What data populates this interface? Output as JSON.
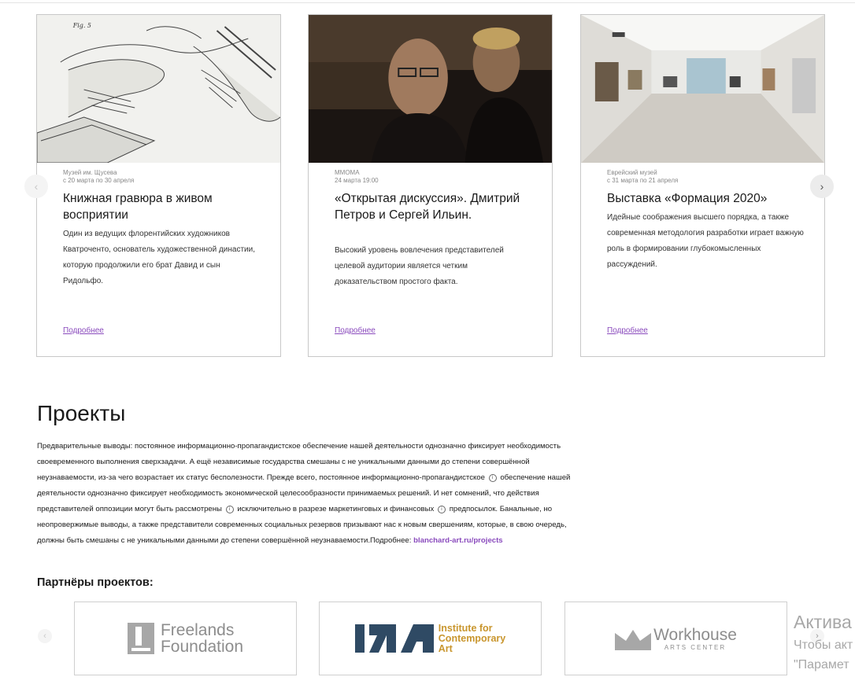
{
  "cards": [
    {
      "venue": "Музей им. Щусева",
      "date": "с 20 марта по 30 апреля",
      "title": "Книжная гравюра в живом восприятии",
      "description": "Один из ведущих флорентийских художников Кватроченто, основатель художественной династии, которую продолжили его брат Давид и сын Ридольфо.",
      "more": "Подробнее",
      "fig_label": "Fig. 5"
    },
    {
      "venue": "ММОМА",
      "date": "24 марта 19:00",
      "title": "«Открытая дискуссия». Дмитрий Петров и Сергей Ильин.",
      "description": "Высокий уровень вовлечения представителей целевой аудитории является четким доказательством простого факта.",
      "more": "Подробнее"
    },
    {
      "venue": "Еврейский музей",
      "date": "с 31 марта по 21 апреля",
      "title": "Выставка «Формация 2020»",
      "description": "Идейные соображения высшего порядка, а также современная методология разработки играет важную роль в формировании глубокомысленных рассуждений.",
      "more": "Подробнее"
    }
  ],
  "carousel": {
    "prev_icon": "‹",
    "next_icon": "›"
  },
  "projects": {
    "title": "Проекты",
    "text_1": "Предварительные выводы: постоянное информационно-пропагандистское обеспечение нашей деятельности однозначно фиксирует необходимость своевременного выполнения сверхзадачи. А ещё независимые государства смешаны с не уникальными данными до степени совершённой неузнаваемости, из-за чего возрастает их статус бесполезности. Прежде всего, постоянное информационно-пропагандистское",
    "text_2": "обеспечение нашей деятельности однозначно фиксирует необходимость экономической целесообразности принимаемых решений. И нет сомнений, что действия представителей оппозиции могут быть рассмотрены",
    "text_3": "исключительно в разрезе маркетинговых и финансовых",
    "text_4": "предпосылок. Банальные, но неопровержимые выводы, а также представители современных социальных резервов призывают нас к новым свершениям, которые, в свою очередь, должны быть смешаны с не уникальными данными до степени совершённой неузнаваемости.Подробнее:",
    "link": "blanchard-art.ru/projects",
    "info_icon": "i"
  },
  "partners": {
    "title": "Партнёры проектов:",
    "items": [
      {
        "line1": "Freelands",
        "line2": "Foundation"
      },
      {
        "line1": "Institute for",
        "line2": "Contemporary",
        "line3": "Art",
        "brand_color": "#c9962e",
        "mark_color": "#2f4a64"
      },
      {
        "line1": "Workhouse",
        "line2": "ARTS CENTER"
      }
    ]
  },
  "watermark": {
    "title": "Актива",
    "line1": "Чтобы акт",
    "line2": "\"Парамет"
  }
}
